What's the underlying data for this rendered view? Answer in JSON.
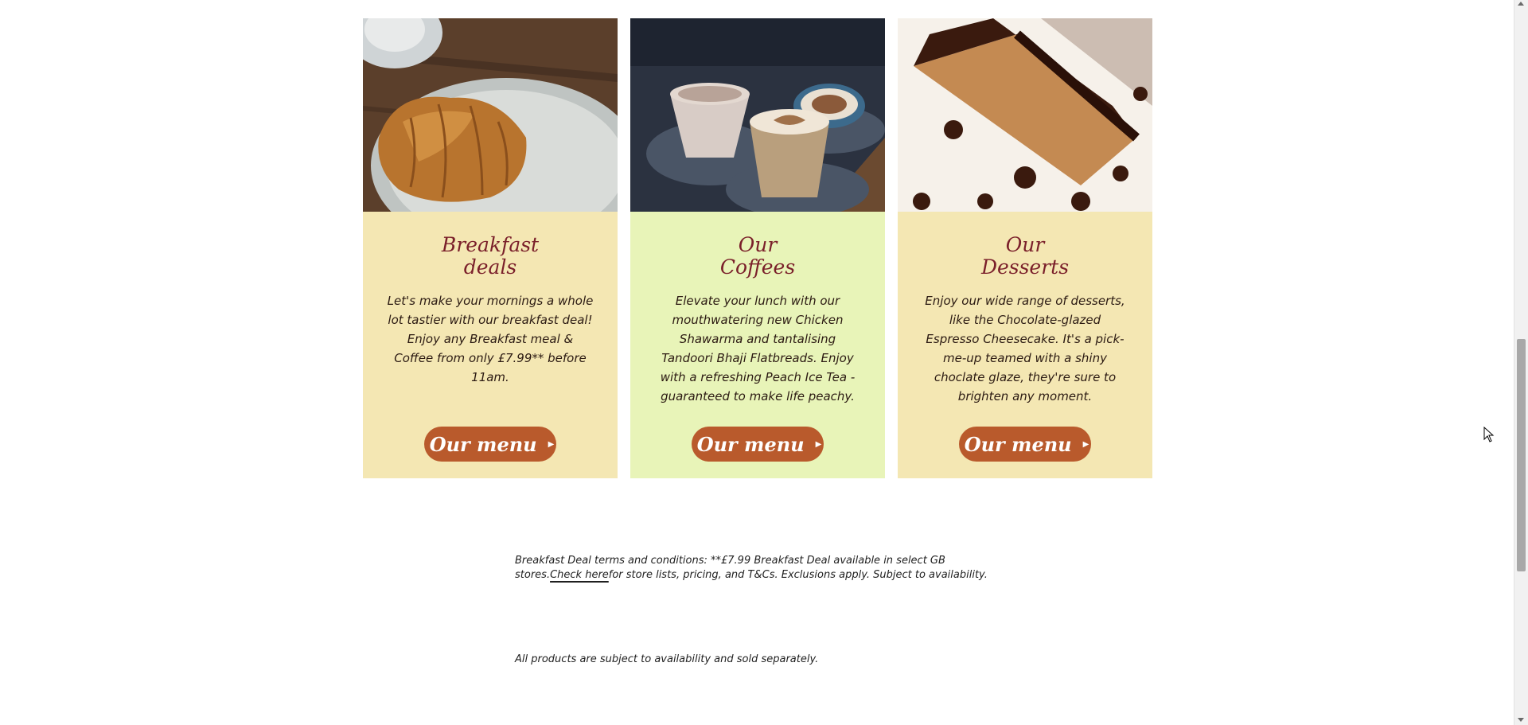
{
  "cards": [
    {
      "title_line1": "Breakfast",
      "title_line2": "deals",
      "text": "Let's make your mornings a whole lot tastier with our breakfast deal! Enjoy any Breakfast meal & Coffee from only £7.99** before 11am.",
      "button_label": "Our menu",
      "image": "croissant-on-plate"
    },
    {
      "title_line1": "Our",
      "title_line2": "Coffees",
      "text": "Elevate your lunch with our mouthwatering new Chicken Shawarma and tantalising Tandoori Bhaji Flatbreads. Enjoy with a refreshing Peach Ice Tea - guaranteed to make life peachy.",
      "button_label": "Our menu",
      "image": "coffee-cups"
    },
    {
      "title_line1": "Our",
      "title_line2": "Desserts",
      "text": "Enjoy our wide range of desserts, like the Chocolate-glazed Espresso Cheesecake. It's a pick-me-up teamed with a shiny choclate glaze, they're sure to brighten any moment.",
      "button_label": "Our menu",
      "image": "chocolate-cake"
    }
  ],
  "footer": {
    "terms_before_link": "Breakfast Deal terms and conditions: **£7.99 Breakfast Deal available in select GB stores.",
    "terms_link": "Check here",
    "terms_after_link": "for store lists, pricing, and T&Cs. Exclusions apply. Subject to availability.",
    "availability": "All products are subject to availability and sold separately."
  },
  "colors": {
    "card_yellow": "#f4e7b3",
    "card_green": "#e8f4b8",
    "title": "#7a1f2a",
    "button": "#b95a2c"
  }
}
